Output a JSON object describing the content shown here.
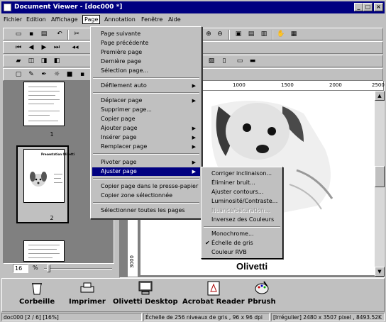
{
  "window": {
    "title": "Document Viewer - [doc000 *]"
  },
  "menubar": [
    "Fichier",
    "Edition",
    "Affichage",
    "Page",
    "Annotation",
    "Fenêtre",
    "Aide"
  ],
  "page_menu": [
    {
      "label": "Page suivante",
      "arrow": false
    },
    {
      "label": "Page précédente",
      "arrow": false
    },
    {
      "label": "Première page",
      "arrow": false
    },
    {
      "label": "Dernière page",
      "arrow": false
    },
    {
      "label": "Sélection page...",
      "arrow": false
    },
    {
      "label": "Défilement auto",
      "arrow": true
    },
    {
      "label": "Déplacer page",
      "arrow": true
    },
    {
      "label": "Supprimer page...",
      "arrow": false
    },
    {
      "label": "Copier page",
      "arrow": false
    },
    {
      "label": "Ajouter page",
      "arrow": true
    },
    {
      "label": "Insérer page",
      "arrow": true
    },
    {
      "label": "Remplacer page",
      "arrow": true
    },
    {
      "label": "Pivoter page",
      "arrow": true
    },
    {
      "label": "Ajuster page",
      "arrow": true,
      "selected": true
    },
    {
      "label": "Copier page dans le presse-papier",
      "arrow": false
    },
    {
      "label": "Copier zone sélectionnée",
      "arrow": false
    },
    {
      "label": "Sélectionner toutes les pages",
      "arrow": false
    }
  ],
  "ajuster_submenu": [
    {
      "label": "Corriger inclinaison...",
      "disabled": false,
      "checked": false
    },
    {
      "label": "Éliminer bruit...",
      "disabled": false,
      "checked": false
    },
    {
      "label": "Ajuster contours...",
      "disabled": false,
      "checked": false
    },
    {
      "label": "Luminosité/Contraste...",
      "disabled": false,
      "checked": false
    },
    {
      "label": "Nuance/Saturation...",
      "disabled": true,
      "checked": false
    },
    {
      "label": "Inversez des Couleurs",
      "disabled": false,
      "checked": false
    },
    {
      "label": "Monochrome...",
      "disabled": false,
      "checked": false
    },
    {
      "label": "Échelle de gris",
      "disabled": false,
      "checked": true
    },
    {
      "label": "Couleur RVB",
      "disabled": false,
      "checked": false
    }
  ],
  "thumbnails": {
    "page1_number": "1",
    "page2_number": "2",
    "page2_heading": "Presentation Olivetti"
  },
  "zoom": {
    "value": "16",
    "unit": "%"
  },
  "ruler": {
    "h_ticks": [
      "1000",
      "1500",
      "2000",
      "2500"
    ],
    "v_tick": "3000"
  },
  "document": {
    "brand_text": "Olivetti"
  },
  "launchbar": [
    "Corbeille",
    "Imprimer",
    "Olivetti Desktop",
    "Acrobat Reader",
    "Pbrush"
  ],
  "status": {
    "doc": "doc000 [2 / 6] [16%]",
    "info": "Échelle de 256 niveaux de gris ,  96 x 96 dpi",
    "size": "[Irrégulier]  2480 x 3507 pixel , 8493.52K"
  },
  "colors": {
    "title_bar": "#000080",
    "highlight": "#000080",
    "face": "#c0c0c0",
    "workspace": "#808080"
  }
}
